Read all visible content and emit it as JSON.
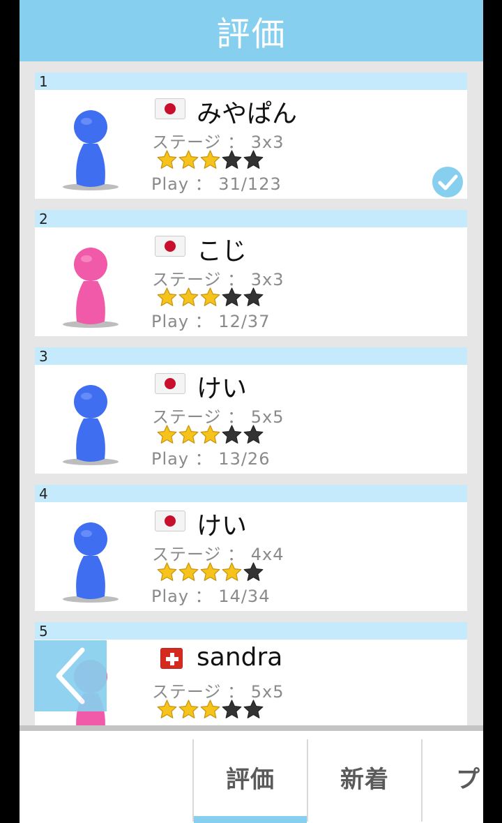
{
  "header": {
    "title": "評価"
  },
  "entries": [
    {
      "rank": "1",
      "name": "みやぱん",
      "country": "jp",
      "stage": "ステージ ： 3x3",
      "stars": 3,
      "play": "Play ： 31/123",
      "avatar_color": "#3f6ef0",
      "checked": true
    },
    {
      "rank": "2",
      "name": "こじ",
      "country": "jp",
      "stage": "ステージ ： 3x3",
      "stars": 3,
      "play": "Play ： 12/37",
      "avatar_color": "#f05aa8",
      "checked": false
    },
    {
      "rank": "3",
      "name": "けい",
      "country": "jp",
      "stage": "ステージ ： 5x5",
      "stars": 3,
      "play": "Play ： 13/26",
      "avatar_color": "#3f6ef0",
      "checked": false
    },
    {
      "rank": "4",
      "name": "けい",
      "country": "jp",
      "stage": "ステージ ： 4x4",
      "stars": 4,
      "play": "Play ： 14/34",
      "avatar_color": "#3f6ef0",
      "checked": false
    },
    {
      "rank": "5",
      "name": "sandra",
      "country": "ch",
      "stage": "ステージ ： 5x5",
      "stars": 3,
      "play": "",
      "avatar_color": "#f05aa8",
      "checked": false
    }
  ],
  "max_stars": 5,
  "tabs": [
    {
      "label": "評価",
      "active": true
    },
    {
      "label": "新着",
      "active": false
    },
    {
      "label": "プ",
      "active": false
    }
  ],
  "icons": {
    "back": "chevron-left-icon",
    "check": "check-circle-icon",
    "star": "star-icon"
  },
  "colors": {
    "accent": "#87cfee",
    "rank_bar": "#c4eafb",
    "star_filled": "#f6c21c",
    "star_empty": "#333333"
  }
}
